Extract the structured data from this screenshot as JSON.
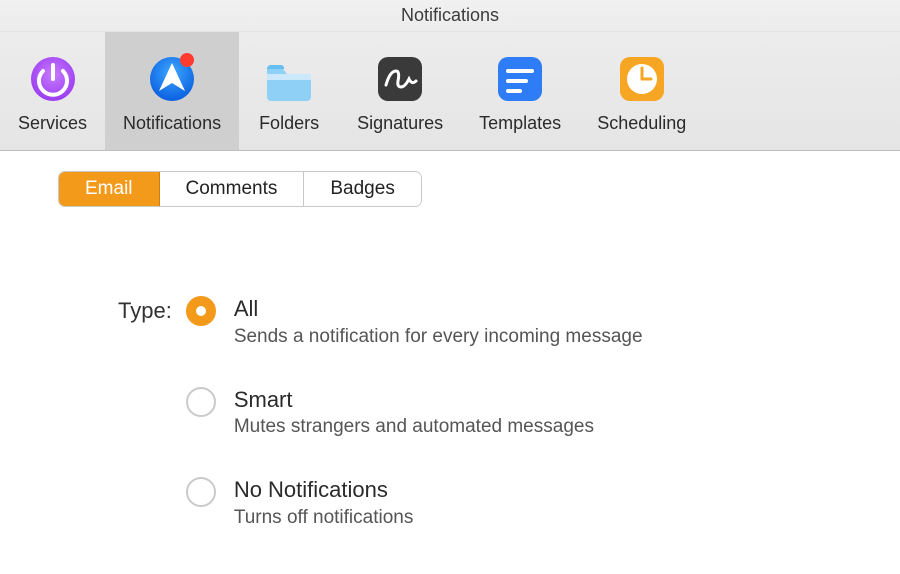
{
  "window": {
    "title": "Notifications"
  },
  "toolbar": {
    "items": [
      {
        "label": "Services"
      },
      {
        "label": "Notifications"
      },
      {
        "label": "Folders"
      },
      {
        "label": "Signatures"
      },
      {
        "label": "Templates"
      },
      {
        "label": "Scheduling"
      }
    ]
  },
  "tabs": {
    "email": "Email",
    "comments": "Comments",
    "badges": "Badges"
  },
  "form": {
    "type_label": "Type:",
    "options": [
      {
        "title": "All",
        "desc": "Sends a notification for every incoming message"
      },
      {
        "title": "Smart",
        "desc": "Mutes strangers and automated messages"
      },
      {
        "title": "No Notifications",
        "desc": "Turns off notifications"
      }
    ]
  }
}
